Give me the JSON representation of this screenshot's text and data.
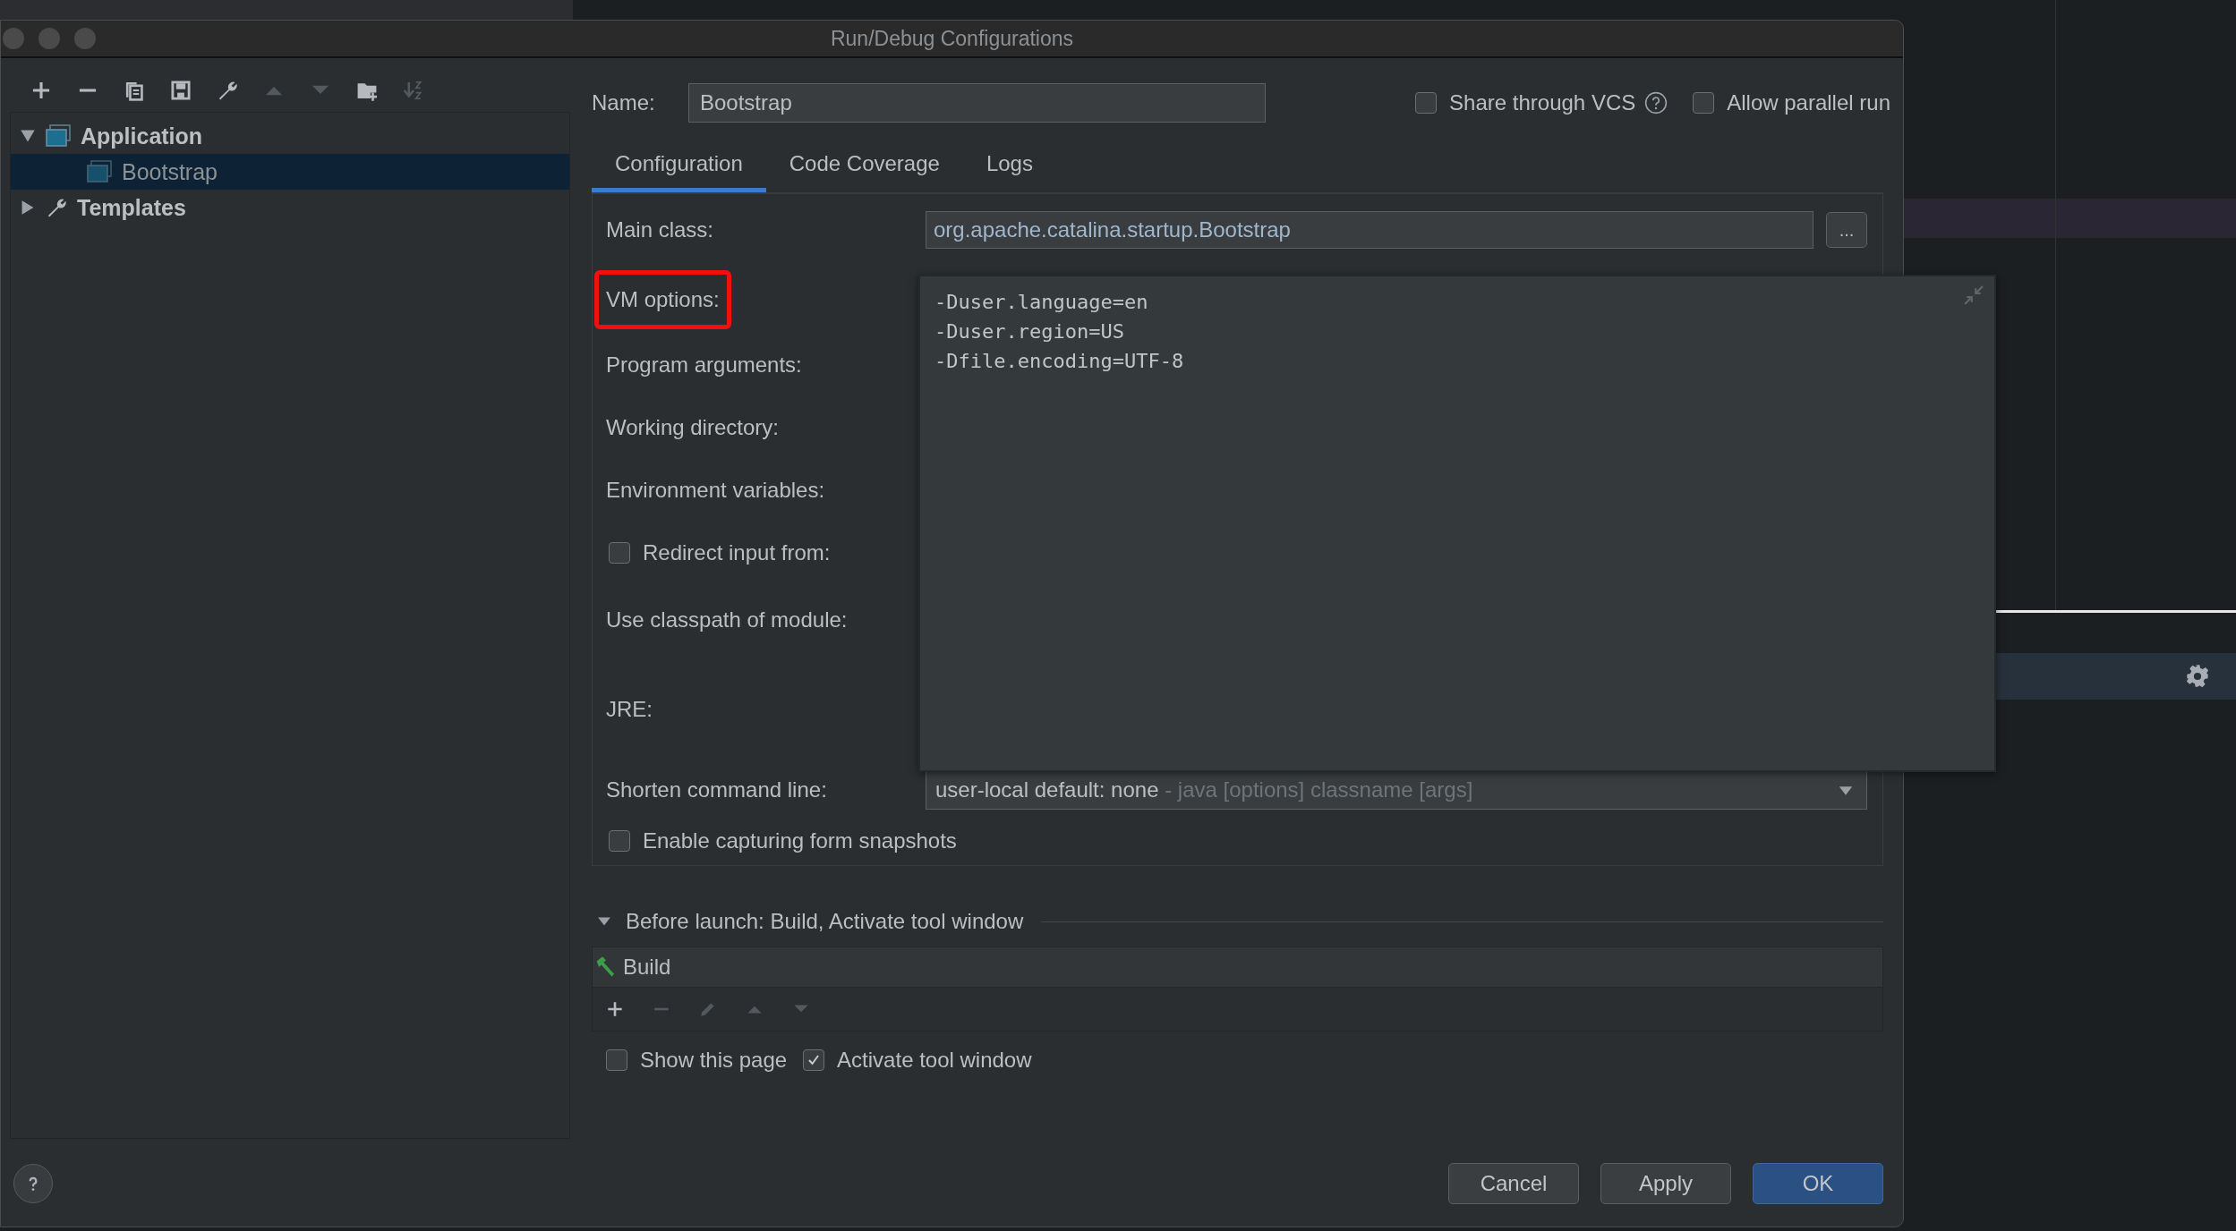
{
  "window": {
    "title": "Run/Debug Configurations"
  },
  "toolbar": [
    {
      "kind": "add",
      "disabled": false
    },
    {
      "kind": "remove",
      "disabled": false
    },
    {
      "kind": "copy",
      "disabled": false
    },
    {
      "kind": "save",
      "disabled": false
    },
    {
      "kind": "wrench",
      "disabled": false
    },
    {
      "kind": "up",
      "disabled": true
    },
    {
      "kind": "down",
      "disabled": true
    },
    {
      "kind": "folder",
      "disabled": false
    },
    {
      "kind": "sort",
      "disabled": true
    }
  ],
  "tree": [
    {
      "label": "Application",
      "kind": "app",
      "expanded": true,
      "selected": false,
      "children": [
        {
          "label": "Bootstrap",
          "kind": "app",
          "selected": true
        }
      ]
    },
    {
      "label": "Templates",
      "kind": "wrench",
      "expanded": false,
      "selected": false
    }
  ],
  "name_field": {
    "label": "Name:",
    "value": "Bootstrap"
  },
  "options": [
    {
      "label": "Share through VCS",
      "checked": false,
      "help": true
    },
    {
      "label": "Allow parallel run",
      "checked": false,
      "help": false
    }
  ],
  "tabs": [
    {
      "label": "Configuration",
      "selected": true
    },
    {
      "label": "Code Coverage",
      "selected": false
    },
    {
      "label": "Logs",
      "selected": false
    }
  ],
  "form": [
    {
      "kind": "field",
      "label": "Main class:",
      "value": "org.apache.catalina.startup.Bootstrap",
      "button": "...",
      "highlighted": false
    },
    {
      "kind": "label",
      "label": "VM options:",
      "highlighted": true
    },
    {
      "kind": "label",
      "label": "Program arguments:",
      "highlighted": false
    },
    {
      "kind": "label",
      "label": "Working directory:",
      "highlighted": false
    },
    {
      "kind": "label",
      "label": "Environment variables:",
      "highlighted": false
    },
    {
      "kind": "checkbox",
      "label": "Redirect input from:",
      "checked": false
    },
    {
      "kind": "label",
      "label": "Use classpath of module:",
      "highlighted": false
    },
    {
      "kind": "label",
      "label": "JRE:",
      "highlighted": false
    },
    {
      "kind": "dropdown",
      "label": "Shorten command line:",
      "value": "user-local default: none",
      "hint": "- java [options] classname [args]"
    },
    {
      "kind": "checkbox",
      "label": "Enable capturing form snapshots",
      "checked": false
    }
  ],
  "vm_options_popup": {
    "lines": [
      "-Duser.language=en",
      "-Duser.region=US",
      "-Dfile.encoding=UTF-8"
    ]
  },
  "before_launch": {
    "title": "Before launch: Build, Activate tool window",
    "expanded": true,
    "tasks": [
      {
        "label": "Build"
      }
    ],
    "toolbar": [
      {
        "kind": "add",
        "disabled": false
      },
      {
        "kind": "remove",
        "disabled": true
      },
      {
        "kind": "edit",
        "disabled": true
      },
      {
        "kind": "up",
        "disabled": true
      },
      {
        "kind": "down",
        "disabled": true
      }
    ]
  },
  "launch_options": [
    {
      "label": "Show this page",
      "checked": false
    },
    {
      "label": "Activate tool window",
      "checked": true
    }
  ],
  "buttons": [
    {
      "label": "Cancel",
      "default": false
    },
    {
      "label": "Apply",
      "default": false
    },
    {
      "label": "OK",
      "default": true
    }
  ]
}
